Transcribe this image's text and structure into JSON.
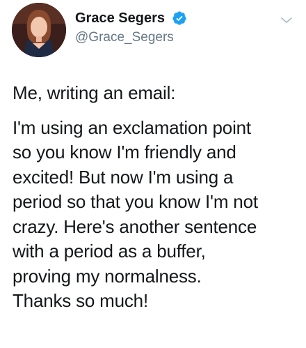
{
  "author": {
    "display_name": "Grace Segers",
    "handle": "@Grace_Segers",
    "verified": true,
    "verified_icon": "verified-badge-icon",
    "accent_color": "#1da1f2"
  },
  "tweet": {
    "intro": "Me, writing an email:",
    "body_lines": [
      "I'm using an exclamation point",
      "so you know I'm friendly and",
      "excited! But now I'm using a",
      "period so that you know I'm not",
      "crazy. Here's another sentence",
      "with a period as a buffer,",
      "proving my normalness.",
      "Thanks so much!"
    ]
  },
  "menu": {
    "icon": "chevron-down-icon"
  }
}
